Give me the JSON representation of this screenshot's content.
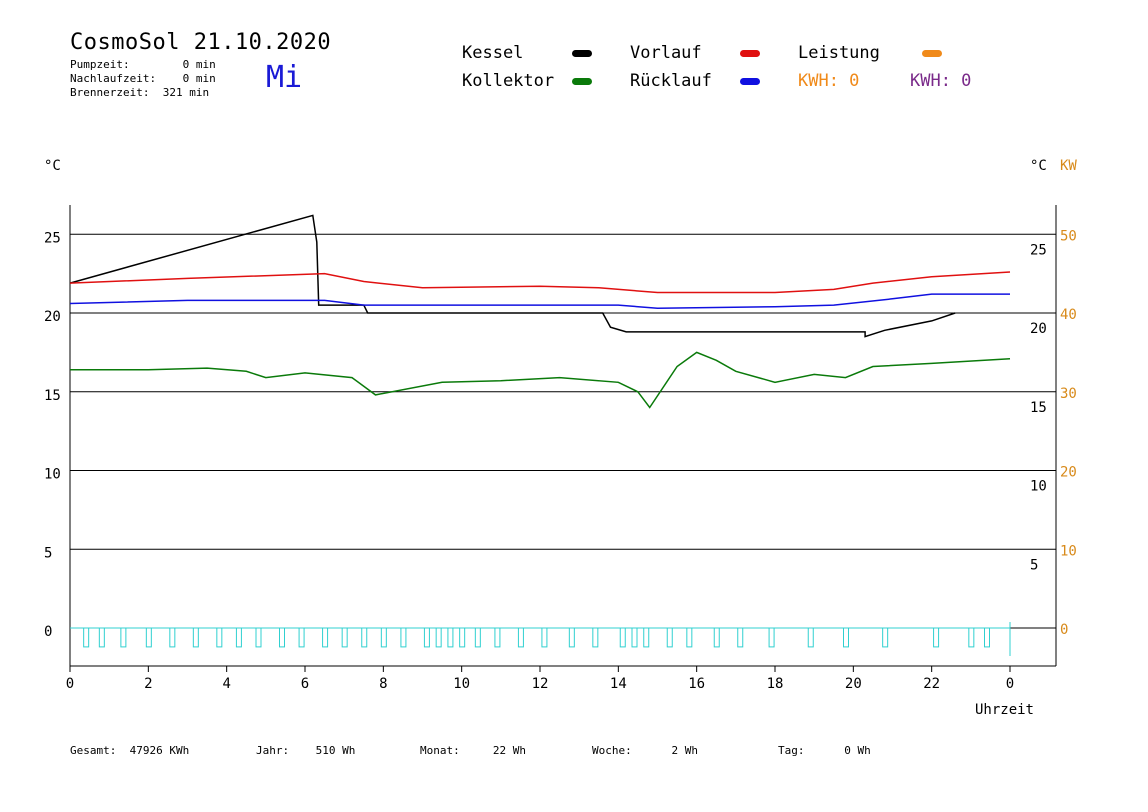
{
  "header": {
    "title": "CosmoSol 21.10.2020",
    "day": "Mi",
    "pumpzeit": "Pumpzeit:        0 min",
    "nachlaufzeit": "Nachlaufzeit:    0 min",
    "brennerzeit": "Brennerzeit:  321 min"
  },
  "legend": {
    "kessel": "Kessel",
    "kollektor": "Kollektor",
    "vorlauf": "Vorlauf",
    "ruecklauf": "Rücklauf",
    "leistung": "Leistung",
    "kwh1": "KWH: 0",
    "kwh2": "KWH: 0",
    "colors": {
      "kessel": "#000000",
      "kollektor": "#0a7a0a",
      "vorlauf": "#e01010",
      "ruecklauf": "#1010e0",
      "leistung": "#f08a1a",
      "kwh2": "#7a2a8a",
      "pump": "#30d0d0"
    }
  },
  "footer": {
    "gesamt": "Gesamt:  47926 KWh",
    "jahr": "Jahr:    510 Wh",
    "monat": "Monat:     22 Wh",
    "woche": "Woche:      2 Wh",
    "tag": "Tag:      0 Wh"
  },
  "chart_data": {
    "type": "line",
    "xlabel": "Uhrzeit",
    "ylabel_left": "°C",
    "ylabel_right": "°C",
    "ylabel_right2": "KW",
    "x_ticks": [
      "0",
      "2",
      "4",
      "6",
      "8",
      "10",
      "12",
      "14",
      "16",
      "18",
      "20",
      "22",
      "0"
    ],
    "x_range": [
      0,
      24
    ],
    "y_left_ticks": [
      "0",
      "5",
      "10",
      "15",
      "20",
      "25"
    ],
    "y_right_ticks": [
      "5",
      "10",
      "15",
      "20",
      "25"
    ],
    "y_kw_ticks": [
      "0",
      "10",
      "20",
      "30",
      "40",
      "50"
    ],
    "ylim": [
      -2,
      27
    ],
    "grid": "horizontal",
    "series": [
      {
        "name": "Kessel",
        "color": "#000000",
        "points": [
          [
            0,
            21.9
          ],
          [
            6.2,
            26.2
          ],
          [
            6.3,
            24.5
          ],
          [
            6.35,
            20.5
          ],
          [
            7.5,
            20.5
          ],
          [
            7.6,
            20.0
          ],
          [
            13.6,
            20.0
          ],
          [
            13.8,
            19.1
          ],
          [
            14.2,
            18.8
          ],
          [
            20.3,
            18.8
          ],
          [
            20.3,
            18.5
          ],
          [
            20.8,
            18.9
          ],
          [
            22.0,
            19.5
          ],
          [
            22.6,
            20.0
          ]
        ]
      },
      {
        "name": "Vorlauf",
        "color": "#e01010",
        "points": [
          [
            0,
            21.9
          ],
          [
            3,
            22.2
          ],
          [
            6.5,
            22.5
          ],
          [
            7.5,
            22.0
          ],
          [
            9,
            21.6
          ],
          [
            12,
            21.7
          ],
          [
            13.5,
            21.6
          ],
          [
            15,
            21.3
          ],
          [
            18,
            21.3
          ],
          [
            19.5,
            21.5
          ],
          [
            20.5,
            21.9
          ],
          [
            22,
            22.3
          ],
          [
            24,
            22.6
          ]
        ]
      },
      {
        "name": "Rücklauf",
        "color": "#1010e0",
        "points": [
          [
            0,
            20.6
          ],
          [
            3,
            20.8
          ],
          [
            6.5,
            20.8
          ],
          [
            7.5,
            20.5
          ],
          [
            12,
            20.5
          ],
          [
            14,
            20.5
          ],
          [
            15,
            20.3
          ],
          [
            18,
            20.4
          ],
          [
            19.5,
            20.5
          ],
          [
            21,
            20.9
          ],
          [
            22,
            21.2
          ],
          [
            24,
            21.2
          ]
        ]
      },
      {
        "name": "Kollektor",
        "color": "#0a7a0a",
        "points": [
          [
            0,
            16.4
          ],
          [
            2,
            16.4
          ],
          [
            3.5,
            16.5
          ],
          [
            4.5,
            16.3
          ],
          [
            5,
            15.9
          ],
          [
            6,
            16.2
          ],
          [
            7.2,
            15.9
          ],
          [
            7.8,
            14.8
          ],
          [
            9.5,
            15.6
          ],
          [
            11,
            15.7
          ],
          [
            12.5,
            15.9
          ],
          [
            14,
            15.6
          ],
          [
            14.5,
            15.0
          ],
          [
            14.8,
            14.0
          ],
          [
            15.5,
            16.6
          ],
          [
            16,
            17.5
          ],
          [
            16.5,
            17.0
          ],
          [
            17,
            16.3
          ],
          [
            18,
            15.6
          ],
          [
            19,
            16.1
          ],
          [
            19.8,
            15.9
          ],
          [
            20.5,
            16.6
          ],
          [
            22,
            16.8
          ],
          [
            24,
            17.1
          ]
        ]
      }
    ],
    "pump_series": {
      "name": "Pumpe",
      "color": "#30d0d0",
      "on_level": 0,
      "off_level": -0.6,
      "pulses_at": [
        0.4,
        0.8,
        1.35,
        2.0,
        2.6,
        3.2,
        3.8,
        4.3,
        4.8,
        5.4,
        5.9,
        6.5,
        7.0,
        7.5,
        8.0,
        8.5,
        9.1,
        9.4,
        9.7,
        10.0,
        10.4,
        10.9,
        11.5,
        12.1,
        12.8,
        13.4,
        14.1,
        14.4,
        14.7,
        15.3,
        15.8,
        16.5,
        17.1,
        17.9,
        18.9,
        19.8,
        20.8,
        22.1,
        23.0,
        23.4
      ]
    }
  }
}
